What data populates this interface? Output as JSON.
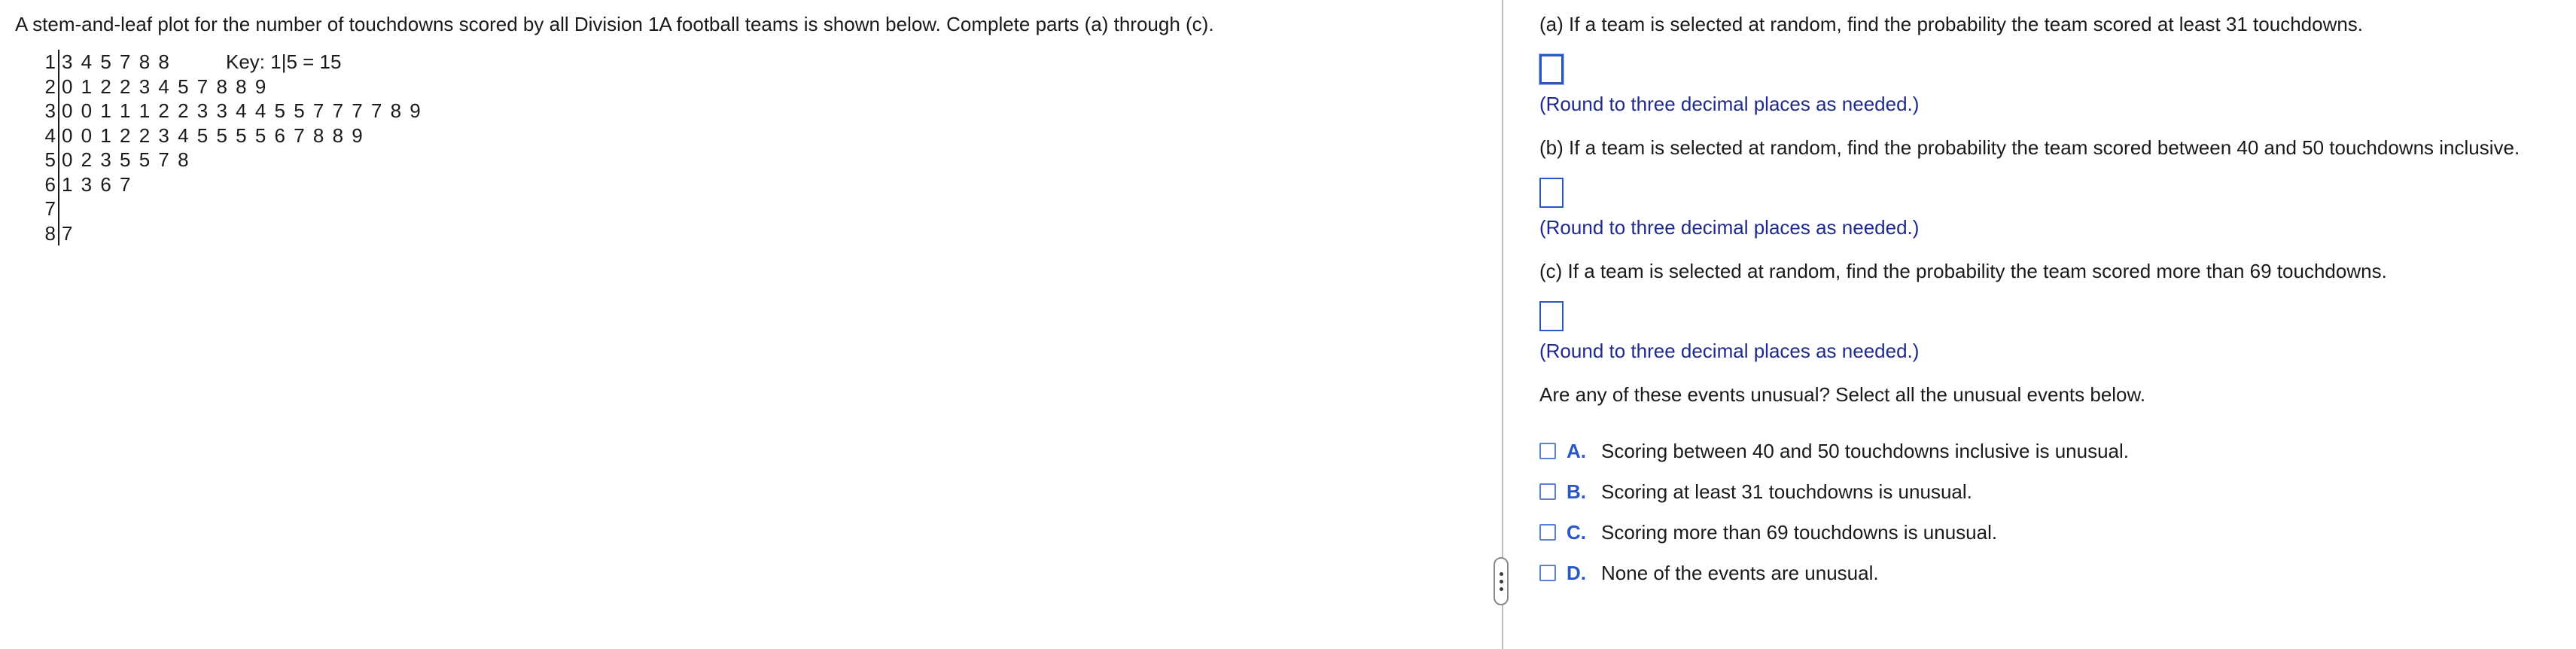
{
  "left": {
    "intro": "A stem-and-leaf plot for the number of touchdowns scored by all Division 1A football teams is shown below. Complete parts (a) through (c).",
    "key": "Key: 1|5 = 15",
    "stem_leaf_rows": [
      {
        "stem": "1",
        "leaves": "3 4 5 7 8 8"
      },
      {
        "stem": "2",
        "leaves": "0 1 2 2 3 4 5 7 8 8 9"
      },
      {
        "stem": "3",
        "leaves": "0 0 1 1 1 2 2 3 3 4 4 5 5 7 7 7 7 8 9"
      },
      {
        "stem": "4",
        "leaves": "0 0 1 2 2 3 4 5 5 5 5 6 7 8 8 9"
      },
      {
        "stem": "5",
        "leaves": "0 2 3 5 5 7 8"
      },
      {
        "stem": "6",
        "leaves": "1 3 6 7"
      },
      {
        "stem": "7",
        "leaves": ""
      },
      {
        "stem": "8",
        "leaves": "7"
      }
    ]
  },
  "right": {
    "part_a": "(a) If a team is selected at random, find the probability the team scored at least 31 touchdowns.",
    "part_b": "(b) If a team is selected at random, find the probability the team scored between 40 and 50 touchdowns inclusive.",
    "part_c": "(c) If a team is selected at random, find the probability the team scored more than 69 touchdowns.",
    "round_note": "(Round to three decimal places as needed.)",
    "unusual_prompt": "Are any of these events unusual? Select all the unusual events below.",
    "choices": [
      {
        "letter": "A.",
        "text": "Scoring between 40 and 50 touchdowns inclusive is unusual."
      },
      {
        "letter": "B.",
        "text": "Scoring at least 31 touchdowns is unusual."
      },
      {
        "letter": "C.",
        "text": "Scoring more than 69 touchdowns is unusual."
      },
      {
        "letter": "D.",
        "text": "None of the events are unusual."
      }
    ]
  }
}
